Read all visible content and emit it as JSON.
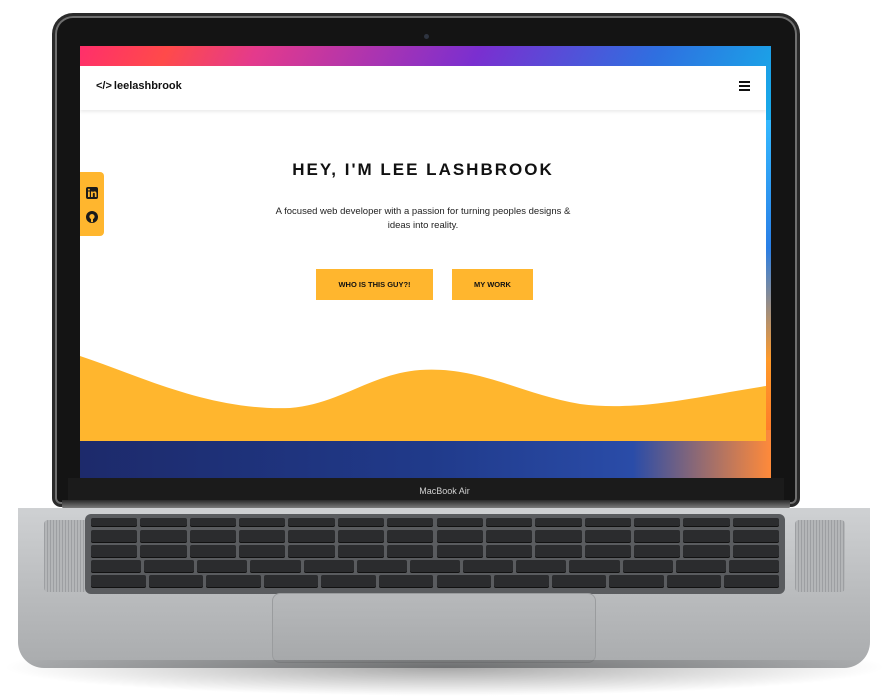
{
  "device": {
    "label": "MacBook Air"
  },
  "site": {
    "logo_code": "</>",
    "logo_text": "leelashbrook",
    "menu_icon": "hamburger-menu-icon",
    "social": [
      {
        "icon": "linkedin-icon"
      },
      {
        "icon": "github-icon"
      }
    ],
    "hero": {
      "heading": "HEY, I'M LEE LASHBROOK",
      "tagline": "A focused web developer with a passion for turning peoples designs & ideas into reality.",
      "primary_button": "WHO IS THIS GUY?!",
      "secondary_button": "MY WORK"
    },
    "colors": {
      "accent": "#ffb62e",
      "text": "#111111",
      "background": "#ffffff"
    }
  }
}
